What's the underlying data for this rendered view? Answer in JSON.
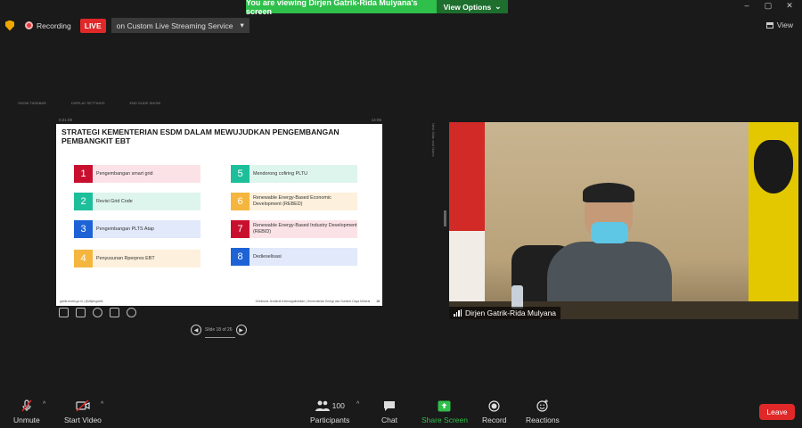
{
  "banner": {
    "message": "You are viewing Dirjen Gatrik-Rida Mulyana's screen",
    "view_options": "View Options",
    "view_options_caret": "⌄"
  },
  "window_controls": [
    "–",
    "▢",
    "✕"
  ],
  "recording": {
    "label": "Recording",
    "live_badge": "LIVE",
    "live_service": "on Custom Live Streaming Service",
    "live_caret": "▾"
  },
  "view_button": {
    "label": "View"
  },
  "shared_screen": {
    "toolbar_items": [
      "SHOW TASKBAR",
      "DISPLAY SETTINGS",
      "END SLIDE SHOW"
    ],
    "elapsed_time": "0:21:09",
    "clock": "14:05",
    "side_label": "Next Slide and Notes",
    "slide_counter": "Slide 18 of 26",
    "nav_prev": "◀",
    "nav_next": "▶"
  },
  "slide": {
    "title": "STRATEGI KEMENTERIAN ESDM DALAM MEWUJUDKAN PENGEMBANGAN PEMBANGKIT EBT",
    "items": [
      {
        "num": "1",
        "text": "Pengembangan smart grid",
        "num_color": "#c8102e",
        "bg_color": "#fbe2e6"
      },
      {
        "num": "2",
        "text": "Revisi Grid Code",
        "num_color": "#1dbf9b",
        "bg_color": "#def5ee"
      },
      {
        "num": "3",
        "text": "Pengembangan PLTS Atap",
        "num_color": "#1e63d6",
        "bg_color": "#e1e9fa"
      },
      {
        "num": "4",
        "text": "Penyusunan Rperpres EBT",
        "num_color": "#f4b63f",
        "bg_color": "#fdf0dc"
      },
      {
        "num": "5",
        "text": "Mendorong cofiring PLTU",
        "num_color": "#1dbf9b",
        "bg_color": "#def5ee"
      },
      {
        "num": "6",
        "text": "Renewable Energy-Based Economic Development (REBED)",
        "num_color": "#f4b63f",
        "bg_color": "#fdf0dc"
      },
      {
        "num": "7",
        "text": "Renewable Energy-Based Industry Development (REBID)",
        "num_color": "#c8102e",
        "bg_color": "#fbe2e6"
      },
      {
        "num": "8",
        "text": "Dedieselisasi",
        "num_color": "#1e63d6",
        "bg_color": "#e1e9fa"
      }
    ],
    "footer_left": "gatrik.esdm.go.id | @ditjengatrik",
    "footer_right": "Direktorat Jenderal Ketenagalistrikan | Kementerian Energi dan Sumber Daya Mineral",
    "page_number": "18"
  },
  "annotation_tools": [
    "pen-icon",
    "stamp-icon",
    "magnifier-icon",
    "subtitles-icon",
    "more-icon"
  ],
  "video": {
    "participant_name": "Dirjen Gatrik-Rida Mulyana"
  },
  "toolbar": {
    "unmute": "Unmute",
    "start_video": "Start Video",
    "participants": "Participants",
    "participants_count": "100",
    "chat": "Chat",
    "share_screen": "Share Screen",
    "record": "Record",
    "reactions": "Reactions",
    "leave": "Leave",
    "caret": "^"
  },
  "colors": {
    "banner_green": "#2fbf4b",
    "share_green": "#2fbf4b",
    "live_red": "#e02828",
    "leave_red": "#e02828"
  }
}
